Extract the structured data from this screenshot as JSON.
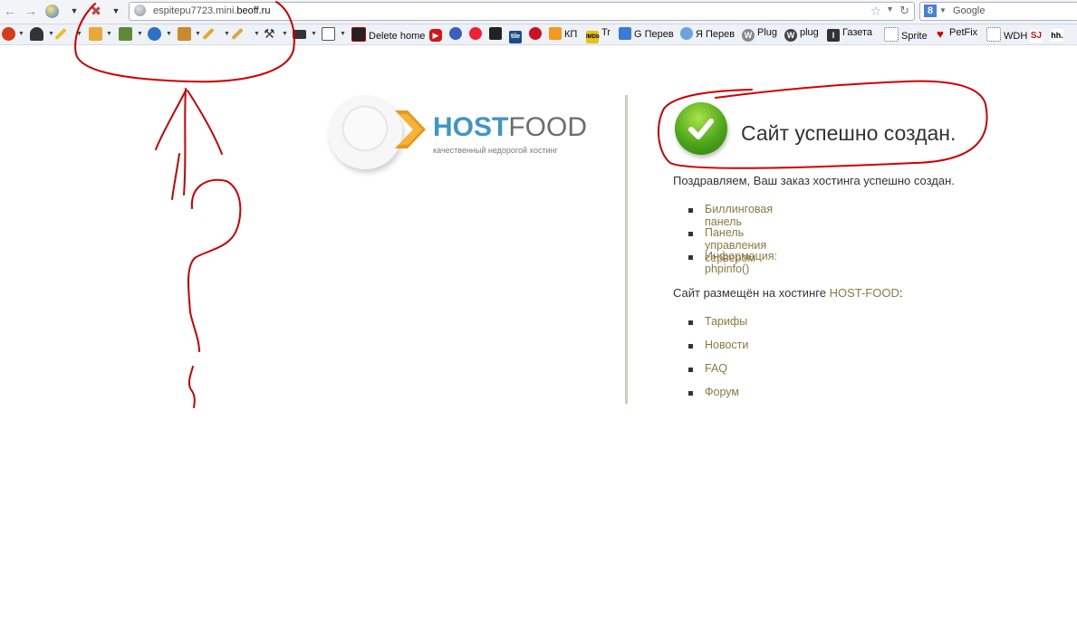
{
  "browser": {
    "url_host": "espitepu7723.mini.",
    "url_domain": "beoff.ru",
    "search_placeholder": "Google",
    "search_engine_letter": "8",
    "bookmarks": [
      {
        "label": "Delete home",
        "icon": "delete-home-icon"
      },
      {
        "label": "",
        "icon": "youtube-icon"
      },
      {
        "label": "КП",
        "icon": "rss-icon"
      },
      {
        "label": "Tr",
        "icon": "imdb-icon"
      },
      {
        "label": "G Перев",
        "icon": "translate-icon"
      },
      {
        "label": "Я Перев",
        "icon": "yandex-translate-icon"
      },
      {
        "label": "Plug",
        "icon": "wordpress-icon"
      },
      {
        "label": "plug",
        "icon": "wordpress-icon"
      },
      {
        "label": "Газета",
        "icon": "newspaper-icon"
      },
      {
        "label": "Sprite",
        "icon": "sprite-icon"
      },
      {
        "label": "PetFix",
        "icon": "heart-icon"
      },
      {
        "label": "WDH",
        "icon": "wdh-icon"
      },
      {
        "label": "SJ",
        "icon": "sj-icon"
      },
      {
        "label": "hh.",
        "icon": "hh-icon"
      }
    ],
    "imdb_text": "IMDb"
  },
  "logo": {
    "host": "HOST",
    "food": "FOOD",
    "tagline": "качественный недорогой хостинг"
  },
  "success": {
    "title": "Сайт успешно создан.",
    "congrats": "Поздравляем, Ваш заказ хостинга успешно создан.",
    "links": [
      "Биллинговая панель",
      "Панель управления сервером",
      "Информация: phpinfo()"
    ],
    "hosted_prefix": "Сайт размещён на хостинге ",
    "hosted_name": "HOST-FOOD",
    "hosted_suffix": ":",
    "hosting_links": [
      "Тарифы",
      "Новости",
      "FAQ",
      "Форум"
    ]
  },
  "colors": {
    "link": "#8c7a43",
    "brand_blue": "#3d97c2",
    "annotation_red": "#d10000",
    "check_green": "#4ea61a"
  }
}
